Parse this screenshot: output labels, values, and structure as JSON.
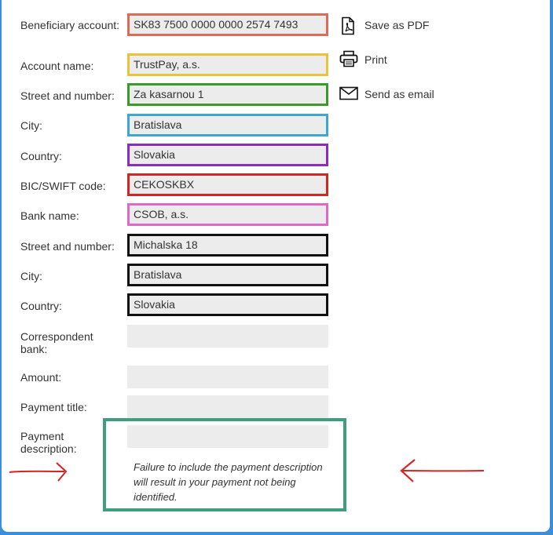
{
  "fields": [
    {
      "label": "Beneficiary account:",
      "value": "SK83 7500 0000 0000 2574 7493",
      "outline": "#e06a55"
    },
    {
      "label": "Account name:",
      "value": "TrustPay, a.s.",
      "outline": "#e8c43a"
    },
    {
      "label": "Street and number:",
      "value": "Za kasarnou 1",
      "outline": "#3a9a2a"
    },
    {
      "label": "City:",
      "value": "Bratislava",
      "outline": "#3aa8d0"
    },
    {
      "label": "Country:",
      "value": "Slovakia",
      "outline": "#8a2bc8"
    },
    {
      "label": "BIC/SWIFT code:",
      "value": "CEKOSKBX",
      "outline": "#d42424"
    },
    {
      "label": "Bank name:",
      "value": "CSOB, a.s.",
      "outline": "#e068c8"
    },
    {
      "label": "Street and number:",
      "value": "Michalska 18",
      "outline": "#111111"
    },
    {
      "label": "City:",
      "value": "Bratislava",
      "outline": "#111111"
    },
    {
      "label": "Country:",
      "value": "Slovakia",
      "outline": "#111111"
    },
    {
      "label": "Correspondent bank:",
      "value": ""
    },
    {
      "label": "Amount:",
      "value": ""
    },
    {
      "label": "Payment title:",
      "value": ""
    },
    {
      "label": "Payment description:",
      "value": ""
    }
  ],
  "actions": [
    {
      "label": "Save as PDF",
      "icon": "pdf-icon"
    },
    {
      "label": "Print",
      "icon": "printer-icon"
    },
    {
      "label": "Send as email",
      "icon": "envelope-icon"
    }
  ],
  "note": "Failure to include the payment description will result in your payment not being identified.",
  "colors": {
    "note_box": "#3f9e7c",
    "annotation_arrows": "#d42424",
    "frame": "#3a8fd6"
  }
}
